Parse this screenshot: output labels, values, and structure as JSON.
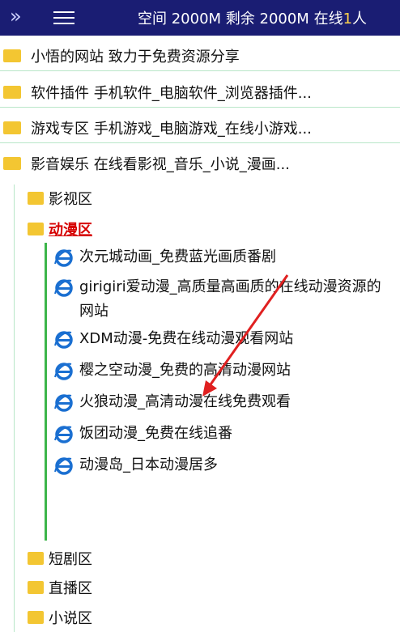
{
  "topbar": {
    "expand_glyph": "»",
    "status_text": "空间 2000M  剩余 2000M  在线",
    "online_count": "1",
    "online_tail": "人"
  },
  "categories": [
    {
      "label": "小悟的网站 致力于免费资源分享"
    },
    {
      "label": "软件插件 手机软件_电脑软件_浏览器插件..."
    },
    {
      "label": "游戏专区 手机游戏_电脑游戏_在线小游戏..."
    },
    {
      "label": "影音娱乐 在线看影视_音乐_小说_漫画..."
    }
  ],
  "subfolders": [
    {
      "label": "影视区"
    },
    {
      "label": "动漫区"
    },
    {
      "label": "短剧区"
    },
    {
      "label": "直播区"
    },
    {
      "label": "小说区"
    }
  ],
  "links": [
    {
      "label": "次元城动画_免费蓝光画质番剧"
    },
    {
      "label": "girigiri爱动漫_高质量高画质的在线动漫资源的网站"
    },
    {
      "label": "XDM动漫-免费在线动漫观看网站"
    },
    {
      "label": "樱之空动漫_免费的高清动漫网站"
    },
    {
      "label": "火狼动漫_高清动漫在线免费观看"
    },
    {
      "label": "饭团动漫_免费在线追番"
    },
    {
      "label": "动漫岛_日本动漫居多"
    }
  ],
  "colors": {
    "topbar_bg": "#1a1d73",
    "folder": "#f3c632",
    "active_text": "#d60000",
    "tree_line": "#3cb54a",
    "ie_icon": "#1a6fd1",
    "annotation_arrow": "#e02020"
  }
}
